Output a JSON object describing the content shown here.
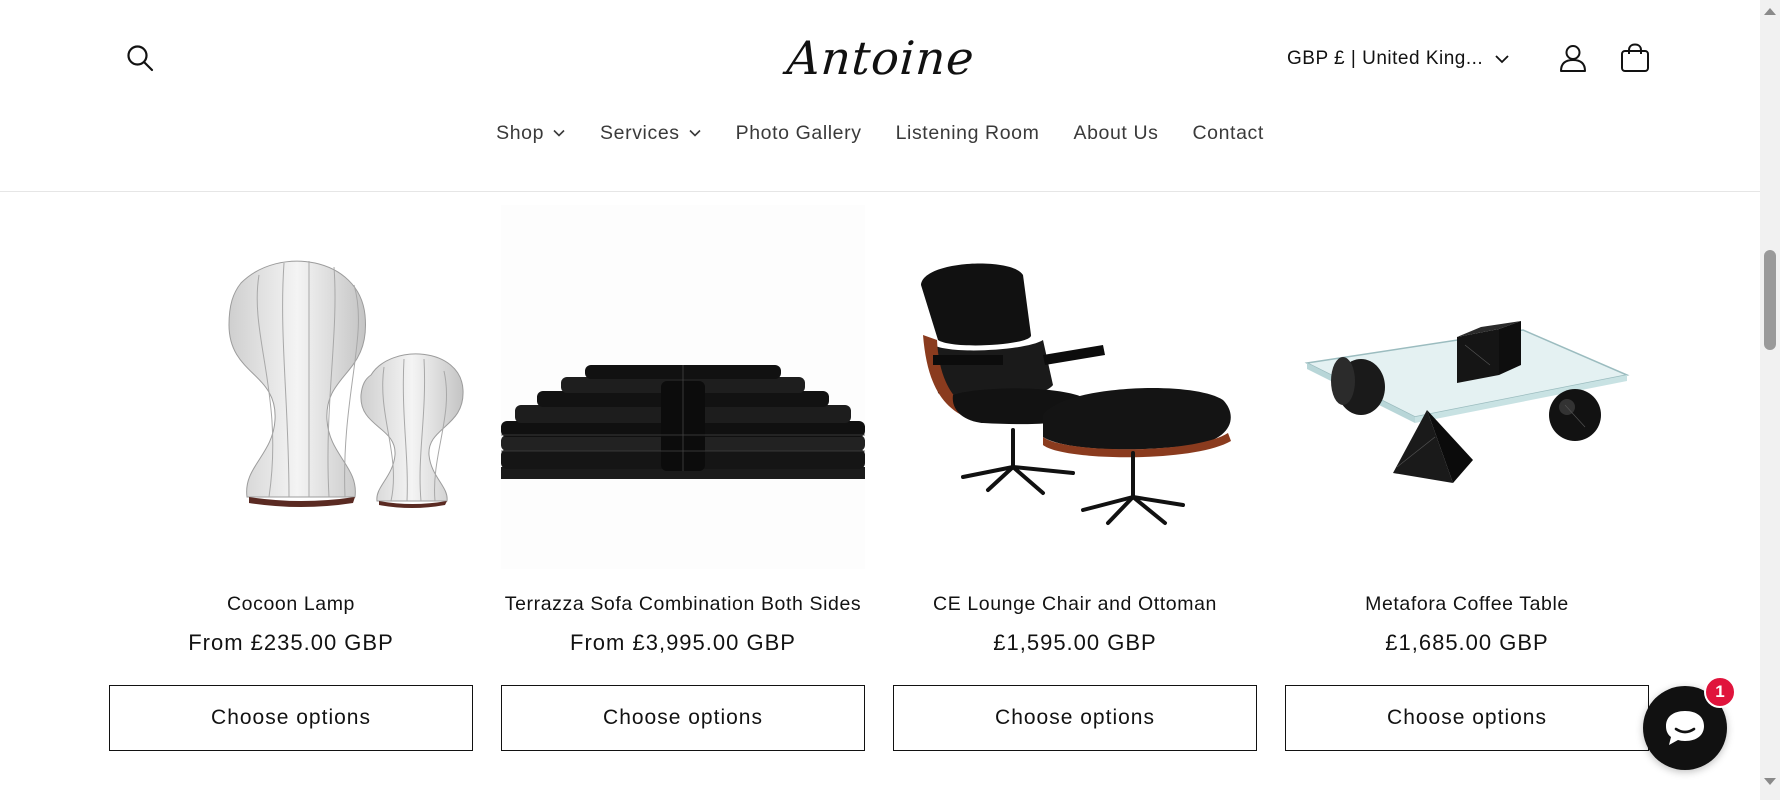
{
  "header": {
    "logo_text": "Antoine",
    "currency_label": "GBP £ | United King...",
    "icons": {
      "search": "search-icon",
      "account": "user-icon",
      "cart": "cart-icon",
      "currency_dropdown": "chevron-down-icon"
    }
  },
  "nav": {
    "items": [
      {
        "label": "Shop",
        "has_dropdown": true
      },
      {
        "label": "Services",
        "has_dropdown": true
      },
      {
        "label": "Photo Gallery",
        "has_dropdown": false
      },
      {
        "label": "Listening Room",
        "has_dropdown": false
      },
      {
        "label": "About Us",
        "has_dropdown": false
      },
      {
        "label": "Contact",
        "has_dropdown": false
      }
    ]
  },
  "products": [
    {
      "title": "Cocoon Lamp",
      "price": "From £235.00 GBP",
      "button": "Choose options",
      "image": "cocoon-lamp-image"
    },
    {
      "title": "Terrazza Sofa Combination Both Sides",
      "price": "From £3,995.00 GBP",
      "button": "Choose options",
      "image": "terrazza-sofa-image"
    },
    {
      "title": "CE Lounge Chair and Ottoman",
      "price": "£1,595.00 GBP",
      "button": "Choose options",
      "image": "lounge-chair-image"
    },
    {
      "title": "Metafora Coffee Table",
      "price": "£1,685.00 GBP",
      "button": "Choose options",
      "image": "coffee-table-image"
    }
  ],
  "chat": {
    "badge_count": "1",
    "icon": "chat-bubble-icon"
  },
  "colors": {
    "text": "#121212",
    "border": "#e6e6e6",
    "chat_bg": "#111111",
    "badge": "#e0143c"
  }
}
